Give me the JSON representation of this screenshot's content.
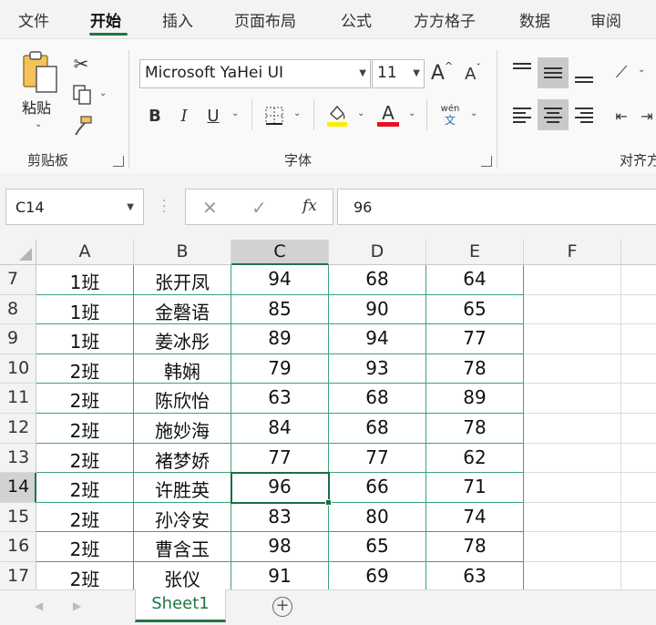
{
  "menu": {
    "tabs": [
      "文件",
      "开始",
      "插入",
      "页面布局",
      "公式",
      "方方格子",
      "数据",
      "审阅"
    ],
    "active_index": 1
  },
  "ribbon": {
    "clipboard": {
      "paste_label": "粘贴",
      "group_label": "剪贴板"
    },
    "font": {
      "font_name": "Microsoft YaHei UI",
      "font_size": "11",
      "grow_label": "A",
      "shrink_label": "A",
      "bold_label": "B",
      "italic_label": "I",
      "underline_label": "U",
      "phonetic_top": "wén",
      "phonetic_bottom": "文",
      "font_color_label": "A",
      "group_label": "字体"
    },
    "alignment": {
      "group_label": "对齐方"
    },
    "colors": {
      "accent": "#217346",
      "highlight": "#ffeb00",
      "font_red": "#e81123"
    }
  },
  "formula_bar": {
    "name_box": "C14",
    "cancel": "✕",
    "enter": "✓",
    "fx": "fx",
    "value": "96"
  },
  "sheet": {
    "columns": [
      "A",
      "B",
      "C",
      "D",
      "E",
      "F"
    ],
    "selected_column": "C",
    "selected_row": "14",
    "active_cell": "C14",
    "rows": [
      {
        "num": "7",
        "cells": [
          "1班",
          "张开凤",
          "94",
          "68",
          "64"
        ]
      },
      {
        "num": "8",
        "cells": [
          "1班",
          "金磬语",
          "85",
          "90",
          "65"
        ]
      },
      {
        "num": "9",
        "cells": [
          "1班",
          "姜冰彤",
          "89",
          "94",
          "77"
        ]
      },
      {
        "num": "10",
        "cells": [
          "2班",
          "韩娴",
          "79",
          "93",
          "78"
        ]
      },
      {
        "num": "11",
        "cells": [
          "2班",
          "陈欣怡",
          "63",
          "68",
          "89"
        ]
      },
      {
        "num": "12",
        "cells": [
          "2班",
          "施妙海",
          "84",
          "68",
          "78"
        ]
      },
      {
        "num": "13",
        "cells": [
          "2班",
          "褚梦娇",
          "77",
          "77",
          "62"
        ]
      },
      {
        "num": "14",
        "cells": [
          "2班",
          "许胜英",
          "96",
          "66",
          "71"
        ]
      },
      {
        "num": "15",
        "cells": [
          "2班",
          "孙冷安",
          "83",
          "80",
          "74"
        ]
      },
      {
        "num": "16",
        "cells": [
          "2班",
          "曹含玉",
          "98",
          "65",
          "78"
        ]
      },
      {
        "num": "17",
        "cells": [
          "2班",
          "张仪",
          "91",
          "69",
          "63"
        ]
      }
    ]
  },
  "sheet_tabs": {
    "tabs": [
      "Sheet1"
    ],
    "add_label": "+"
  }
}
